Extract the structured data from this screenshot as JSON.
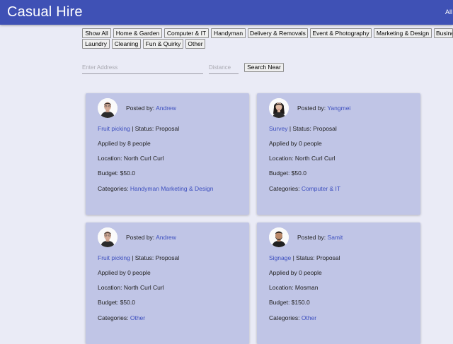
{
  "appbar": {
    "title": "Casual Hire",
    "right_text": "All"
  },
  "categories": [
    "Show All",
    "Home & Garden",
    "Computer & IT",
    "Handyman",
    "Delivery & Removals",
    "Event & Photography",
    "Marketing & Design",
    "Business",
    "Laundry",
    "Cleaning",
    "Fun & Quirky",
    "Other"
  ],
  "search": {
    "address_placeholder": "Enter Address",
    "distance_placeholder": "Distance",
    "button": "Search Near"
  },
  "labels": {
    "posted_by": "Posted by:",
    "status_prefix": " | Status: ",
    "applied_prefix": "Applied by ",
    "applied_suffix": " people",
    "location_prefix": "Location: ",
    "budget_prefix": "Budget: ",
    "categories_prefix": "Categories: "
  },
  "jobs": [
    {
      "poster": "Andrew",
      "avatar": "man-avatar-icon",
      "title": "Fruit picking",
      "status": "Proposal",
      "applied": "8",
      "location": "North Curl Curl",
      "budget": "$50.0",
      "categories": "Handyman Marketing & Design"
    },
    {
      "poster": "Yangmei",
      "avatar": "woman-avatar-icon",
      "title": "Survey",
      "status": "Proposal",
      "applied": "0",
      "location": "North Curl Curl",
      "budget": "$50.0",
      "categories": "Computer & IT"
    },
    {
      "poster": "Andrew",
      "avatar": "man-avatar-icon",
      "title": "Fruit picking",
      "status": "Proposal",
      "applied": "0",
      "location": "North Curl Curl",
      "budget": "$50.0",
      "categories": "Other"
    },
    {
      "poster": "Samit",
      "avatar": "bearded-man-avatar-icon",
      "title": "Signage",
      "status": "Proposal",
      "applied": "0",
      "location": "Mosman",
      "budget": "$150.0",
      "categories": "Other"
    }
  ]
}
